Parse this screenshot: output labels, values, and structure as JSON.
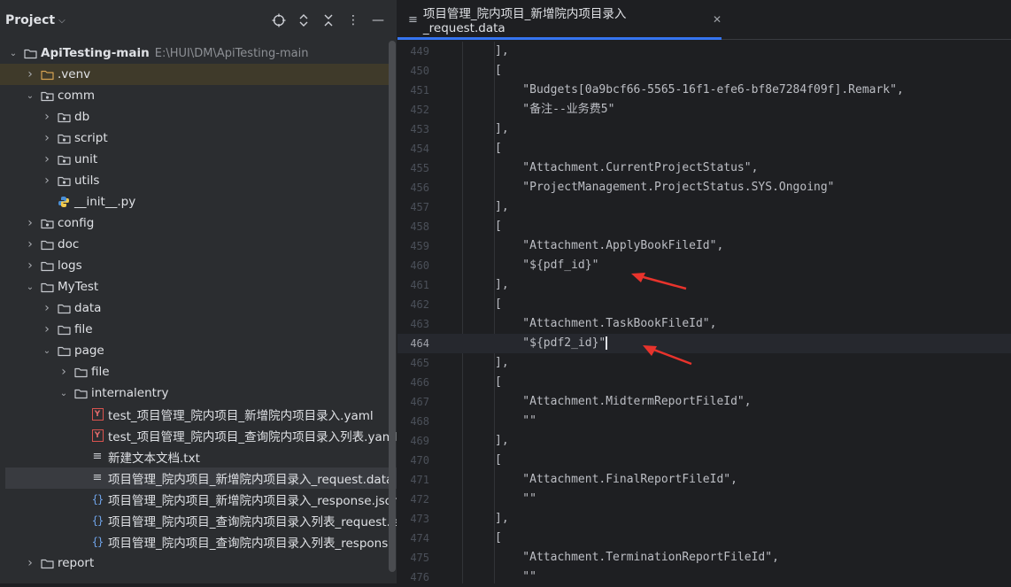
{
  "panel": {
    "title": "Project",
    "toolbar_icons": [
      "crosshair-icon",
      "expand-collapse-icon",
      "close-all-icon",
      "more-vert-icon",
      "minimize-icon"
    ]
  },
  "tree": [
    {
      "name": "tree-root",
      "label": "ApiTesting-main",
      "path": "E:\\HUI\\DM\\ApiTesting-main",
      "depth": 0,
      "type": "folder",
      "expanded": true,
      "bold": true
    },
    {
      "name": "tree-venv",
      "label": ".venv",
      "depth": 1,
      "type": "folder",
      "expanded": false,
      "highlight": true
    },
    {
      "name": "tree-comm",
      "label": "comm",
      "depth": 1,
      "type": "package",
      "expanded": true
    },
    {
      "name": "tree-db",
      "label": "db",
      "depth": 2,
      "type": "package",
      "expanded": false
    },
    {
      "name": "tree-script",
      "label": "script",
      "depth": 2,
      "type": "package",
      "expanded": false
    },
    {
      "name": "tree-unit",
      "label": "unit",
      "depth": 2,
      "type": "package",
      "expanded": false
    },
    {
      "name": "tree-utils",
      "label": "utils",
      "depth": 2,
      "type": "package",
      "expanded": false
    },
    {
      "name": "tree-init-py",
      "label": "__init__.py",
      "depth": 2,
      "type": "python",
      "leaf": true
    },
    {
      "name": "tree-config",
      "label": "config",
      "depth": 1,
      "type": "package",
      "expanded": false
    },
    {
      "name": "tree-doc",
      "label": "doc",
      "depth": 1,
      "type": "folder",
      "expanded": false
    },
    {
      "name": "tree-logs",
      "label": "logs",
      "depth": 1,
      "type": "folder",
      "expanded": false
    },
    {
      "name": "tree-mytest",
      "label": "MyTest",
      "depth": 1,
      "type": "folder",
      "expanded": true
    },
    {
      "name": "tree-data",
      "label": "data",
      "depth": 2,
      "type": "folder",
      "expanded": false
    },
    {
      "name": "tree-file",
      "label": "file",
      "depth": 2,
      "type": "folder",
      "expanded": false
    },
    {
      "name": "tree-page",
      "label": "page",
      "depth": 2,
      "type": "folder",
      "expanded": true
    },
    {
      "name": "tree-page-file",
      "label": "file",
      "depth": 3,
      "type": "folder",
      "expanded": false
    },
    {
      "name": "tree-internalentry",
      "label": "internalentry",
      "depth": 3,
      "type": "folder",
      "expanded": true
    },
    {
      "name": "tree-yaml-add",
      "label": "test_项目管理_院内项目_新增院内项目录入.yaml",
      "depth": 4,
      "type": "yaml",
      "leaf": true
    },
    {
      "name": "tree-yaml-query",
      "label": "test_项目管理_院内项目_查询院内项目录入列表.yaml",
      "depth": 4,
      "type": "yaml",
      "leaf": true
    },
    {
      "name": "tree-new-txt",
      "label": "新建文本文档.txt",
      "depth": 4,
      "type": "text",
      "leaf": true
    },
    {
      "name": "tree-request-data",
      "label": "项目管理_院内项目_新增院内项目录入_request.data",
      "depth": 4,
      "type": "text",
      "leaf": true,
      "selected": true
    },
    {
      "name": "tree-response-json",
      "label": "项目管理_院内项目_新增院内项目录入_response.json",
      "depth": 4,
      "type": "json",
      "leaf": true
    },
    {
      "name": "tree-list-request-json",
      "label": "项目管理_院内项目_查询院内项目录入列表_request.json",
      "depth": 4,
      "type": "json",
      "leaf": true
    },
    {
      "name": "tree-list-response-json",
      "label": "项目管理_院内项目_查询院内项目录入列表_response.json",
      "depth": 4,
      "type": "json",
      "leaf": true
    },
    {
      "name": "tree-report",
      "label": "report",
      "depth": 1,
      "type": "folder",
      "expanded": false
    }
  ],
  "editor": {
    "tab_label": "项目管理_院内项目_新增院内项目录入_request.data",
    "current_line": 464,
    "lines": [
      {
        "n": "449",
        "text": "],"
      },
      {
        "n": "450",
        "text": "["
      },
      {
        "n": "451",
        "text": "    \"Budgets[0a9bcf66-5565-16f1-efe6-bf8e7284f09f].Remark\","
      },
      {
        "n": "452",
        "text": "    \"备注--业务费5\""
      },
      {
        "n": "453",
        "text": "],"
      },
      {
        "n": "454",
        "text": "["
      },
      {
        "n": "455",
        "text": "    \"Attachment.CurrentProjectStatus\","
      },
      {
        "n": "456",
        "text": "    \"ProjectManagement.ProjectStatus.SYS.Ongoing\""
      },
      {
        "n": "457",
        "text": "],"
      },
      {
        "n": "458",
        "text": "["
      },
      {
        "n": "459",
        "text": "    \"Attachment.ApplyBookFileId\","
      },
      {
        "n": "460",
        "text": "    \"${pdf_id}\""
      },
      {
        "n": "461",
        "text": "],"
      },
      {
        "n": "462",
        "text": "["
      },
      {
        "n": "463",
        "text": "    \"Attachment.TaskBookFileId\","
      },
      {
        "n": "464",
        "text": "    \"${pdf2_id}\""
      },
      {
        "n": "465",
        "text": "],"
      },
      {
        "n": "466",
        "text": "["
      },
      {
        "n": "467",
        "text": "    \"Attachment.MidtermReportFileId\","
      },
      {
        "n": "468",
        "text": "    \"\""
      },
      {
        "n": "469",
        "text": "],"
      },
      {
        "n": "470",
        "text": "["
      },
      {
        "n": "471",
        "text": "    \"Attachment.FinalReportFileId\","
      },
      {
        "n": "472",
        "text": "    \"\""
      },
      {
        "n": "473",
        "text": "],"
      },
      {
        "n": "474",
        "text": "["
      },
      {
        "n": "475",
        "text": "    \"Attachment.TerminationReportFileId\","
      },
      {
        "n": "476",
        "text": "    \"\""
      }
    ]
  },
  "colors": {
    "accent": "#3574f0",
    "arrow": "#e8332c",
    "highlight_row": "#3f3a2a"
  }
}
